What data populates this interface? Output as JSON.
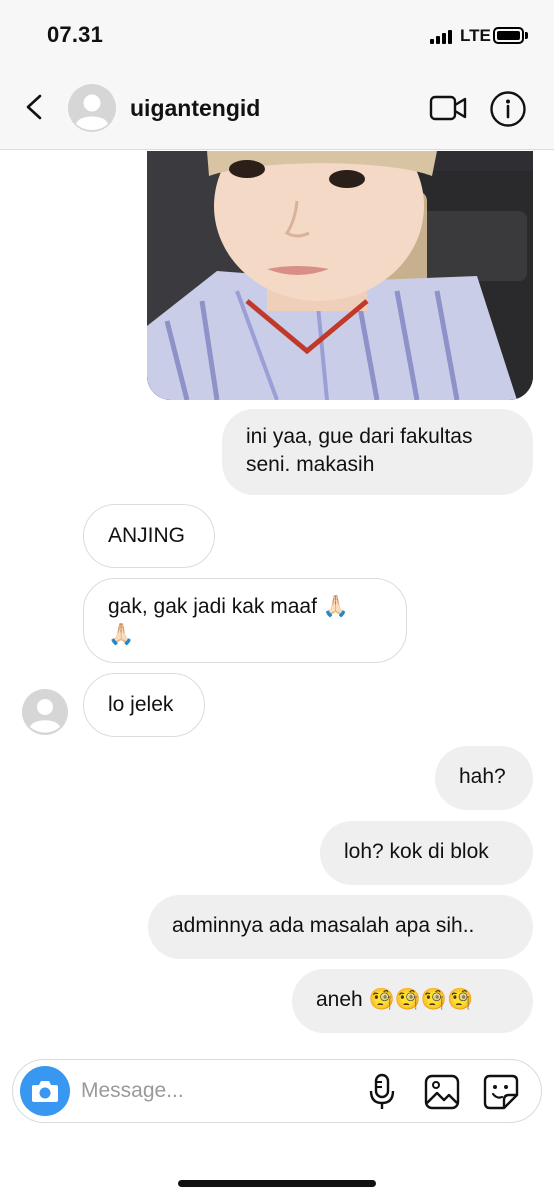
{
  "status_bar": {
    "time": "07.31",
    "network": "LTE"
  },
  "header": {
    "username": "uigantengid",
    "icons": [
      "back-chevron-icon",
      "avatar-placeholder-icon",
      "video-call-icon",
      "info-icon"
    ]
  },
  "messages": [
    {
      "direction": "outgoing",
      "type": "photo",
      "description_icon": "photo-attachment"
    },
    {
      "direction": "outgoing",
      "type": "text",
      "text": "ini yaa, gue dari fakultas\nseni. makasih"
    },
    {
      "direction": "incoming",
      "type": "text",
      "text": "ANJING"
    },
    {
      "direction": "incoming",
      "type": "text",
      "text": "gak, gak jadi kak maaf 🙏🏻\n🙏🏻"
    },
    {
      "direction": "incoming",
      "type": "text",
      "text": "lo jelek"
    },
    {
      "direction": "outgoing",
      "type": "text",
      "text": "hah?"
    },
    {
      "direction": "outgoing",
      "type": "text",
      "text": "loh? kok di blok"
    },
    {
      "direction": "outgoing",
      "type": "text",
      "text": "adminnya ada masalah apa sih.."
    },
    {
      "direction": "outgoing",
      "type": "text",
      "text": "aneh 🧐🧐🧐🧐"
    }
  ],
  "composer": {
    "placeholder": "Message...",
    "value": "",
    "icons": [
      "camera-icon",
      "microphone-icon",
      "gallery-icon",
      "sticker-icon"
    ]
  },
  "colors": {
    "accent": "#3897f0",
    "outgoing_bubble": "#efefef",
    "incoming_border": "#dcdcdc",
    "header_bg": "#f7f7f7"
  }
}
